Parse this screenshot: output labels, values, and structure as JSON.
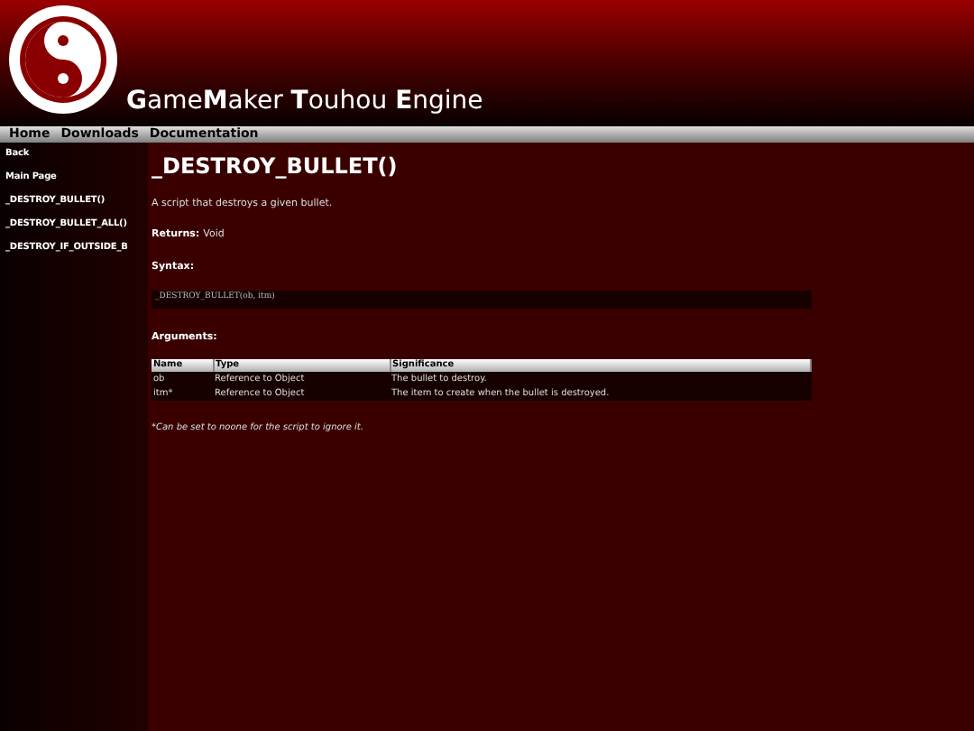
{
  "site_title": "**G**ame**M**aker **T**ouhou **E**ngine",
  "nav": [
    "Home",
    "Downloads",
    "Documentation"
  ],
  "sidebar": {
    "items": [
      "Back",
      "Main Page",
      "_DESTROY_BULLET()",
      "_DESTROY_BULLET_ALL()",
      "_DESTROY_IF_OUTSIDE_B"
    ]
  },
  "heading": "_DESTROY_BULLET()",
  "description": "A script that destroys a given bullet.",
  "returns": {
    "label": "Returns:",
    "value": "Void"
  },
  "syntax": {
    "label": "Syntax:",
    "code": "_DESTROY_BULLET(ob, itm)"
  },
  "arguments": {
    "label": "Arguments:",
    "columns": [
      "Name",
      "Type",
      "Significance"
    ],
    "rows": [
      [
        "ob",
        "Reference to Object",
        "The bullet to destroy."
      ],
      [
        "itm*",
        "Reference to Object",
        "The item to create when the bullet is destroyed."
      ]
    ]
  },
  "footnote": "*Can be set to noone for the script to ignore it."
}
